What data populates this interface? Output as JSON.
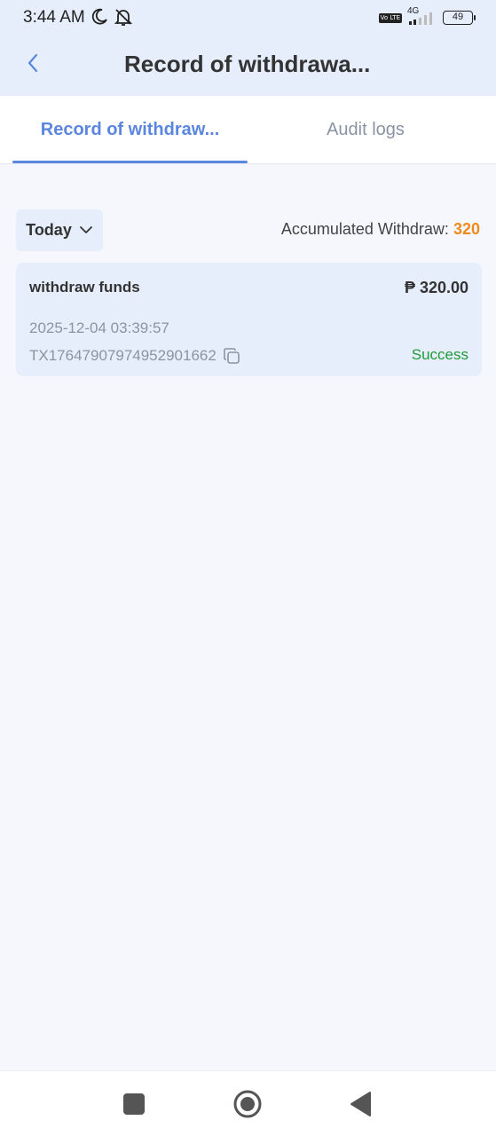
{
  "status_bar": {
    "time": "3:44 AM",
    "volte_label": "Vo LTE",
    "network": "4G",
    "battery": "49"
  },
  "header": {
    "title": "Record of withdrawa..."
  },
  "tabs": [
    {
      "label": "Record of withdraw...",
      "active": true
    },
    {
      "label": "Audit logs",
      "active": false
    }
  ],
  "filter": {
    "selected": "Today",
    "accumulated_label": "Accumulated Withdraw:",
    "accumulated_value": "320"
  },
  "records": [
    {
      "title": "withdraw funds",
      "amount": "₱ 320.00",
      "date": "2025-12-04 03:39:57",
      "tx_id": "TX17647907974952901662",
      "status": "Success"
    }
  ],
  "colors": {
    "accent": "#5b86e0",
    "header_bg": "#e6eefb",
    "page_bg": "#f5f7fd",
    "accum_value": "#f08a1c",
    "success": "#1f9a3a"
  },
  "icons": {
    "back": "chevron-left-icon",
    "filter": "chevron-down-icon",
    "copy": "copy-icon",
    "status_moon": "moon-icon",
    "status_bell": "bell-off-icon"
  }
}
